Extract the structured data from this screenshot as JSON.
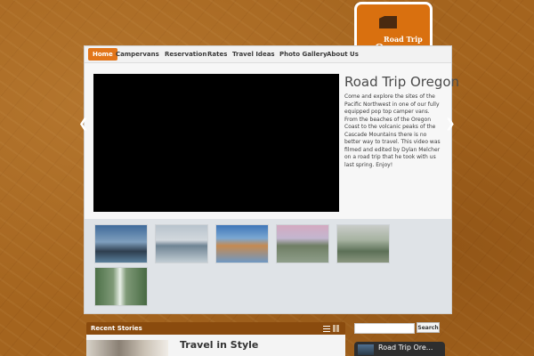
{
  "logo": {
    "line1": "Road Trip",
    "line2": "Oregon"
  },
  "nav": {
    "items": [
      {
        "label": "Home",
        "active": true
      },
      {
        "label": "Campervans"
      },
      {
        "label": "Reservation"
      },
      {
        "label": "Rates"
      },
      {
        "label": "Travel Ideas"
      },
      {
        "label": "Photo Gallery"
      },
      {
        "label": "About Us"
      }
    ]
  },
  "hero": {
    "title": "Road Trip Oregon",
    "description": "Come and explore the sites of the Pacific Northwest in one of our fully equipped pop top camper vans.  From the beaches of the Oregon Coast to the volcanic peaks of the Cascade Mountains there is no better way to travel.  This video was filmed and edited by Dylan Melcher on a road trip that he took with us last spring.   Enjoy!"
  },
  "arrows": {
    "prev": "❮",
    "next": "❯"
  },
  "stories": {
    "header": "Recent Stories",
    "first_title": "Travel in Style"
  },
  "search": {
    "button_label": "Search",
    "value": ""
  },
  "video_widget": {
    "title": "Road Trip Ore..."
  },
  "colors": {
    "accent": "#e2751a",
    "brand_dark": "#8a4b0e",
    "background": "#a4641e"
  }
}
